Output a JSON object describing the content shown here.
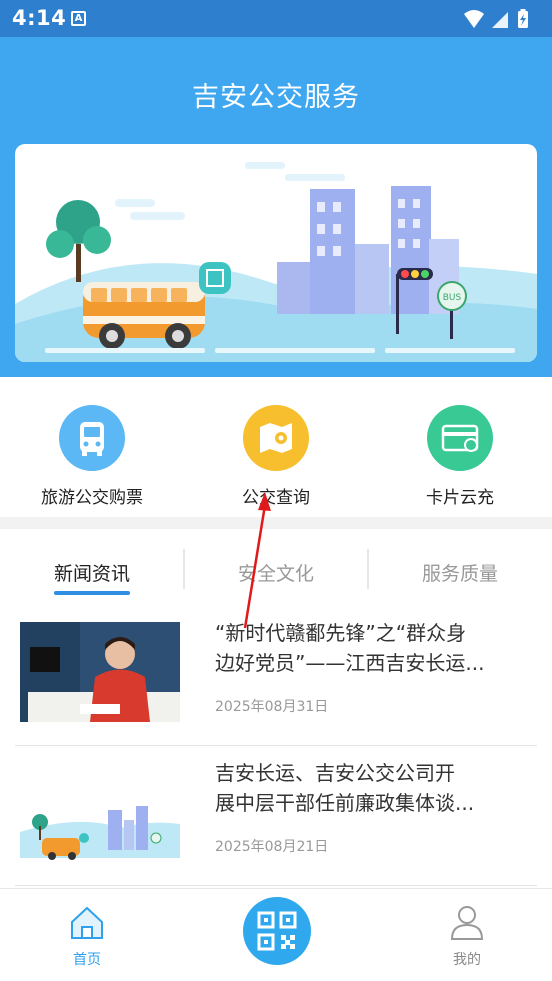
{
  "status_bar": {
    "time": "4:14",
    "notification_glyph": "A"
  },
  "header": {
    "title": "吉安公交服务"
  },
  "banner": {
    "bus_stop_sign": "BUS"
  },
  "quick_menu": [
    {
      "label": "旅游公交购票",
      "icon": "bus-icon",
      "color": "#5bb8f5"
    },
    {
      "label": "公交查询",
      "icon": "map-icon",
      "color": "#f7be2d"
    },
    {
      "label": "卡片云充",
      "icon": "card-icon",
      "color": "#38c995"
    }
  ],
  "tabs": [
    {
      "label": "新闻资讯",
      "active": true
    },
    {
      "label": "安全文化",
      "active": false
    },
    {
      "label": "服务质量",
      "active": false
    }
  ],
  "news": [
    {
      "title": "“新时代赣鄱先锋”之“群众身边好党员”——江西吉安长运...",
      "line1": "“新时代赣鄱先锋”之“群众身",
      "line2": "边好党员”——江西吉安长运...",
      "date": "2025年08月31日"
    },
    {
      "title": "吉安长运、吉安公交公司开展中层干部任前廉政集体谈...",
      "line1": "吉安长运、吉安公交公司开",
      "line2": "展中层干部任前廉政集体谈...",
      "date": "2025年08月21日"
    }
  ],
  "bottom_nav": {
    "home": "首页",
    "mine": "我的"
  },
  "colors": {
    "primary": "#3ea7f0",
    "status_bar": "#2f7fcf",
    "accent": "#2f8de4",
    "annotation": "#e01a1a"
  }
}
